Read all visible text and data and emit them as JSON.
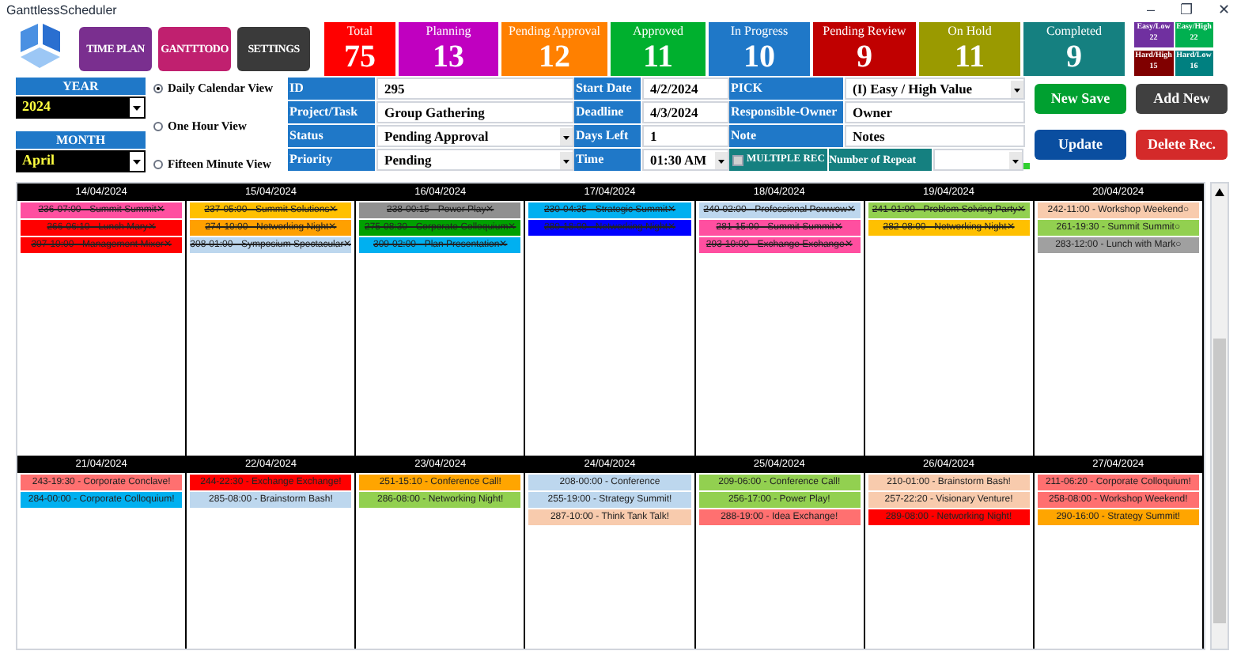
{
  "window": {
    "title": "GanttlessScheduler",
    "controls": [
      "–",
      "❐",
      "✕"
    ]
  },
  "nav_buttons": [
    {
      "label": "TIME PLAN",
      "color": "#7a2f8f"
    },
    {
      "label": "GANTTTODO",
      "color": "#c0206f"
    },
    {
      "label": "SETTINGS",
      "color": "#3a3a3a"
    }
  ],
  "stats": [
    {
      "label": "Total",
      "count": "75",
      "color": "#ff0000"
    },
    {
      "label": "Planning",
      "count": "13",
      "color": "#c000c0"
    },
    {
      "label": "Pending Approval",
      "count": "12",
      "color": "#ff8000"
    },
    {
      "label": "Approved",
      "count": "11",
      "color": "#00b02e"
    },
    {
      "label": "In Progress",
      "count": "10",
      "color": "#1f78c8"
    },
    {
      "label": "Pending Review",
      "count": "9",
      "color": "#c00000"
    },
    {
      "label": "On Hold",
      "count": "11",
      "color": "#9a9a00"
    },
    {
      "label": "Completed",
      "count": "9",
      "color": "#158080"
    }
  ],
  "priority_stats": [
    {
      "label": "Easy/Low",
      "count": "22",
      "color": "#7030a0"
    },
    {
      "label": "Easy/High",
      "count": "22",
      "color": "#00b050"
    },
    {
      "label": "Hard/High",
      "count": "15",
      "color": "#800000"
    },
    {
      "label": "Hard/Low",
      "count": "16",
      "color": "#008080"
    }
  ],
  "year": {
    "label": "YEAR",
    "value": "2024"
  },
  "month": {
    "label": "MONTH",
    "value": "April"
  },
  "views": [
    {
      "label": "Daily Calendar View",
      "selected": true
    },
    {
      "label": "One Hour View",
      "selected": false
    },
    {
      "label": "Fifteen Minute View",
      "selected": false
    }
  ],
  "form_columns": [
    [
      {
        "label": "ID",
        "value": "295",
        "kind": "text"
      },
      {
        "label": "Project/Task",
        "value": "Group Gathering",
        "kind": "text"
      },
      {
        "label": "Status",
        "value": "Pending Approval",
        "kind": "select"
      },
      {
        "label": "Priority",
        "value": "Pending",
        "kind": "select"
      }
    ],
    [
      {
        "label": "Start Date",
        "value": "4/2/2024",
        "kind": "text"
      },
      {
        "label": "Deadline",
        "value": "4/3/2024",
        "kind": "text"
      },
      {
        "label": "Days Left",
        "value": "1",
        "kind": "text"
      },
      {
        "label": "Time",
        "value": "01:30 AM",
        "kind": "select"
      }
    ],
    [
      {
        "label": "PICK",
        "value": "(I) Easy / High Value",
        "kind": "select"
      },
      {
        "label": "Responsible-Owner",
        "value": "Owner",
        "kind": "text"
      },
      {
        "label": "Note",
        "value": "Notes",
        "kind": "text"
      }
    ]
  ],
  "multiple_rec": {
    "label": "MULTIPLE REC",
    "checked": false
  },
  "repeat": {
    "label": "Number of Repeat"
  },
  "actions": [
    {
      "label": "New Save",
      "color": "#00a030"
    },
    {
      "label": "Add New",
      "color": "#404040"
    },
    {
      "label": "Update",
      "color": "#0a4ea0"
    },
    {
      "label": "Delete Rec.",
      "color": "#d42a2a"
    }
  ],
  "weeks": [
    {
      "days": [
        {
          "date": "14/04/2024",
          "events": [
            {
              "label": "236-07:00 - Summit Summit✕",
              "color": "#ff4fa0",
              "done": true
            },
            {
              "label": "266-06:10 - Lunch Mary✕",
              "color": "#ff0000",
              "done": true
            },
            {
              "label": "307-10:00 - Management Mixer✕",
              "color": "#ff0000",
              "done": true
            }
          ]
        },
        {
          "date": "15/04/2024",
          "events": [
            {
              "label": "237-05:00 - Summit Solutions✕",
              "color": "#ffc000",
              "done": true
            },
            {
              "label": "274-10:00 - Networking Night✕",
              "color": "#ffa000",
              "done": true
            },
            {
              "label": "308-01:00 - Symposium Spectacular✕",
              "color": "#bdd7ee",
              "done": true
            }
          ]
        },
        {
          "date": "16/04/2024",
          "events": [
            {
              "label": "238-00:15 - Power Play✕",
              "color": "#909090",
              "done": true
            },
            {
              "label": "275-08:30 - Corporate Colloquium✕",
              "color": "#00a000",
              "done": true
            },
            {
              "label": "309-02:00 - Plan Presentation✕",
              "color": "#00b0f0",
              "done": true
            }
          ]
        },
        {
          "date": "17/04/2024",
          "events": [
            {
              "label": "230-04:35 - Strategic Summit✕",
              "color": "#00b0f0",
              "done": true
            },
            {
              "label": "280-18:00 - Networking Night✕",
              "color": "#0000ff",
              "done": true
            }
          ]
        },
        {
          "date": "18/04/2024",
          "events": [
            {
              "label": "240-02:00 - Professional Powwow✕",
              "color": "#bdd7ee",
              "done": true
            },
            {
              "label": "281-15:00 - Summit Summit✕",
              "color": "#ff4fa0",
              "done": true
            },
            {
              "label": "293-10:00 - Exchange Exchange✕",
              "color": "#ff4fa0",
              "done": true
            }
          ]
        },
        {
          "date": "19/04/2024",
          "events": [
            {
              "label": "241-01:00 - Problem Solving Party✕",
              "color": "#92d050",
              "done": true
            },
            {
              "label": "282-08:00 - Networking Night✕",
              "color": "#ffc000",
              "done": true
            }
          ]
        },
        {
          "date": "20/04/2024",
          "events": [
            {
              "label": "242-11:00 - Workshop Weekend○",
              "color": "#f8cbad",
              "done": false
            },
            {
              "label": "261-19:30 - Summit Summit○",
              "color": "#92d050",
              "done": false
            },
            {
              "label": "283-12:00 - Lunch with Mark○",
              "color": "#a0a0a0",
              "done": false
            }
          ]
        }
      ]
    },
    {
      "days": [
        {
          "date": "21/04/2024",
          "events": [
            {
              "label": "243-19:30 - Corporate Conclave!",
              "color": "#ff7070",
              "done": false
            },
            {
              "label": "284-00:00 - Corporate Colloquium!",
              "color": "#00b0f0",
              "done": false
            }
          ]
        },
        {
          "date": "22/04/2024",
          "events": [
            {
              "label": "244-22:30 - Exchange Exchange!",
              "color": "#ff0000",
              "done": false
            },
            {
              "label": "285-08:00 - Brainstorm Bash!",
              "color": "#bdd7ee",
              "done": false
            }
          ]
        },
        {
          "date": "23/04/2024",
          "events": [
            {
              "label": "251-15:10 - Conference Call!",
              "color": "#ffa500",
              "done": false
            },
            {
              "label": "286-08:00 - Networking Night!",
              "color": "#92d050",
              "done": false
            }
          ]
        },
        {
          "date": "24/04/2024",
          "events": [
            {
              "label": "208-00:00 - Conference",
              "color": "#bdd7ee",
              "done": false
            },
            {
              "label": "255-19:00 - Strategy Summit!",
              "color": "#bdd7ee",
              "done": false
            },
            {
              "label": "287-10:00 - Think Tank Talk!",
              "color": "#f8cbad",
              "done": false
            }
          ]
        },
        {
          "date": "25/04/2024",
          "events": [
            {
              "label": "209-06:00 - Conference Call!",
              "color": "#92d050",
              "done": false
            },
            {
              "label": "256-17:00 - Power Play!",
              "color": "#92d050",
              "done": false
            },
            {
              "label": "288-19:00 - Idea Exchange!",
              "color": "#ff7070",
              "done": false
            }
          ]
        },
        {
          "date": "26/04/2024",
          "events": [
            {
              "label": "210-01:00 - Brainstorm Bash!",
              "color": "#f8cbad",
              "done": false
            },
            {
              "label": "257-22:20 - Visionary Venture!",
              "color": "#f8cbad",
              "done": false
            },
            {
              "label": "289-08:00 - Networking Night!",
              "color": "#ff0000",
              "done": false
            }
          ]
        },
        {
          "date": "27/04/2024",
          "events": [
            {
              "label": "211-06:20 - Corporate Colloquium!",
              "color": "#ff7070",
              "done": false
            },
            {
              "label": "258-08:00 - Workshop Weekend!",
              "color": "#ff7070",
              "done": false
            },
            {
              "label": "290-16:00 - Strategy Summit!",
              "color": "#ffa500",
              "done": false
            }
          ]
        }
      ]
    }
  ]
}
